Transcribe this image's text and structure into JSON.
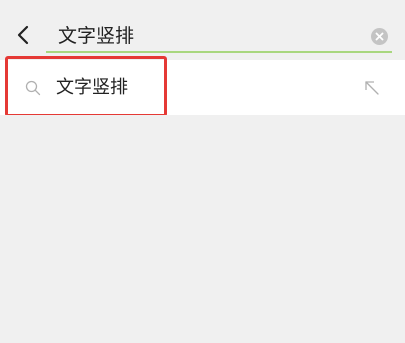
{
  "search": {
    "value": "文字竖排",
    "placeholder": ""
  },
  "suggestions": [
    {
      "label": "文字竖排"
    }
  ],
  "colors": {
    "underline": "#a9d77f",
    "highlight": "#e53935",
    "clear_button": "#c4c4c4"
  },
  "icons": {
    "back": "chevron-left-icon",
    "clear": "clear-circle-icon",
    "search": "search-icon",
    "fill": "arrow-up-left-icon"
  }
}
